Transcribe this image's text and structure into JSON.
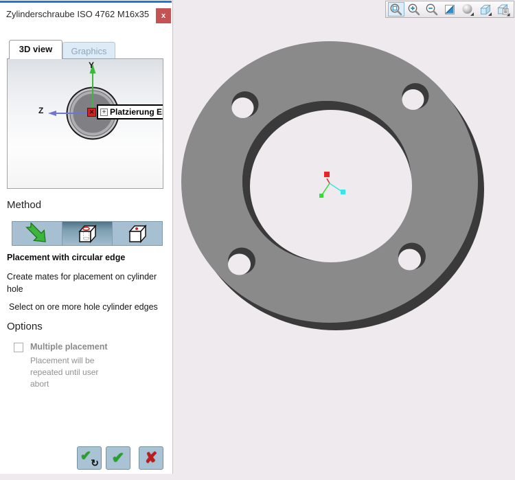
{
  "panel": {
    "title": "Zylinderschraube ISO 4762 M16x35",
    "close_glyph": "x",
    "tabs": [
      {
        "label": "3D view",
        "active": true
      },
      {
        "label": "Graphics",
        "active": false
      }
    ],
    "preview": {
      "axis_y_label": "Y",
      "axis_z_label": "Z",
      "callout_plus_glyph": "+",
      "callout_label": "Platzierung Ebene"
    },
    "method": {
      "heading": "Method",
      "buttons": [
        {
          "icon": "free-placement-arrow-icon",
          "selected": false
        },
        {
          "icon": "cube-circular-hole-icon",
          "selected": true
        },
        {
          "icon": "cube-point-icon",
          "selected": false
        }
      ],
      "selected_title": "Placement with circular edge",
      "description": "Create mates for placement on cylinder hole",
      "hint": "Select on ore more hole cylinder edges"
    },
    "options": {
      "heading": "Options",
      "checkbox_label": "Multiple placement",
      "checkbox_checked": false,
      "desc": [
        "Placement will be",
        "repeated until user",
        "abort"
      ]
    },
    "actions": {
      "check_glyph": "✔",
      "repeat_glyph": "↻",
      "cancel_glyph": "✘"
    }
  },
  "toolbar": {
    "items": [
      {
        "icon": "zoom-window-icon",
        "selected": true
      },
      {
        "icon": "zoom-in-icon",
        "selected": false
      },
      {
        "icon": "zoom-out-icon",
        "selected": false
      },
      {
        "icon": "shaded-view-icon",
        "selected": false
      },
      {
        "icon": "render-sphere-icon",
        "selected": false
      },
      {
        "icon": "view-cube-icon",
        "selected": false
      },
      {
        "icon": "cube-properties-icon",
        "selected": false
      }
    ]
  },
  "scene": {
    "part": "flange with 4 bolt holes",
    "colors": {
      "part_gray": "#8a8a8a",
      "extrusion_shadow": "#3a3a3a",
      "background": "#eeeaee",
      "triad_x": "#e82525",
      "triad_y": "#35dc35",
      "triad_z": "#38e6e6"
    }
  },
  "theme": {
    "accent_blue": "#1b7bd0",
    "close_red": "#c45353",
    "button_steel_blue": "#a9c3d5"
  }
}
